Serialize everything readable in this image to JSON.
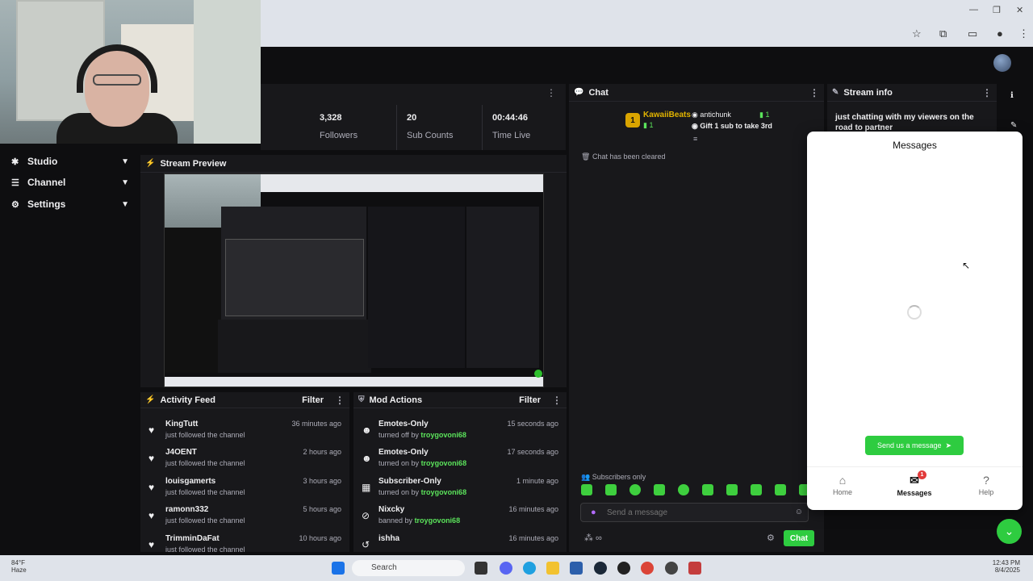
{
  "sidebar": {
    "items": [
      {
        "label": "Studio",
        "icon": "studio-icon"
      },
      {
        "label": "Channel",
        "icon": "channel-icon"
      },
      {
        "label": "Settings",
        "icon": "gear-icon"
      }
    ]
  },
  "stats": {
    "followers_value": "3,328",
    "followers_label": "Followers",
    "subs_value": "20",
    "subs_label": "Sub Counts",
    "time_value": "00:44:46",
    "time_label": "Time Live"
  },
  "preview": {
    "title": "Stream Preview"
  },
  "activity": {
    "title": "Activity Feed",
    "filter": "Filter",
    "rows": [
      {
        "name": "KingTutt",
        "sub": "just followed the channel",
        "time": "36 minutes ago"
      },
      {
        "name": "J4OENT",
        "sub": "just followed the channel",
        "time": "2 hours ago"
      },
      {
        "name": "louisgamerts",
        "sub": "just followed the channel",
        "time": "3 hours ago"
      },
      {
        "name": "ramonn332",
        "sub": "just followed the channel",
        "time": "5 hours ago"
      },
      {
        "name": "TrimminDaFat",
        "sub": "just followed the channel",
        "time": "10 hours ago"
      }
    ]
  },
  "mod": {
    "title": "Mod Actions",
    "filter": "Filter",
    "rows": [
      {
        "name": "Emotes-Only",
        "action": "turned off by",
        "by": "troygovoni68",
        "time": "15 seconds ago"
      },
      {
        "name": "Emotes-Only",
        "action": "turned on by",
        "by": "troygovoni68",
        "time": "17 seconds ago"
      },
      {
        "name": "Subscriber-Only",
        "action": "turned on by",
        "by": "troygovoni68",
        "time": "1 minute ago"
      },
      {
        "name": "Nixcky",
        "action": "banned by",
        "by": "troygovoni68",
        "time": "16 minutes ago"
      },
      {
        "name": "ishha",
        "action": "",
        "by": "",
        "time": "16 minutes ago"
      }
    ]
  },
  "chat": {
    "title": "Chat",
    "pinned_user1": "KawaiiBeats",
    "pinned_user1_count": "1",
    "pinned_user2": "antichunk",
    "pinned_user2_count": "1",
    "pinned_text": "Gift 1 sub to take 3rd",
    "cleared": "Chat has been cleared",
    "subs_only": "Subscribers only",
    "input_placeholder": "Send a message",
    "send_label": "Chat"
  },
  "stream_info": {
    "title": "Stream info",
    "text": "just chatting with my viewers on the road to partner"
  },
  "messages": {
    "title": "Messages",
    "send_button": "Send us a message",
    "nav": [
      {
        "label": "Home"
      },
      {
        "label": "Messages",
        "badge": "1"
      },
      {
        "label": "Help"
      }
    ]
  },
  "taskbar": {
    "temp": "84°F",
    "weather": "Haze",
    "search": "Search",
    "time": "12:43 PM",
    "date": "8/4/2025"
  },
  "colors": {
    "accent": "#2ecc40",
    "panel": "#18181b",
    "bg": "#0e0e10"
  }
}
